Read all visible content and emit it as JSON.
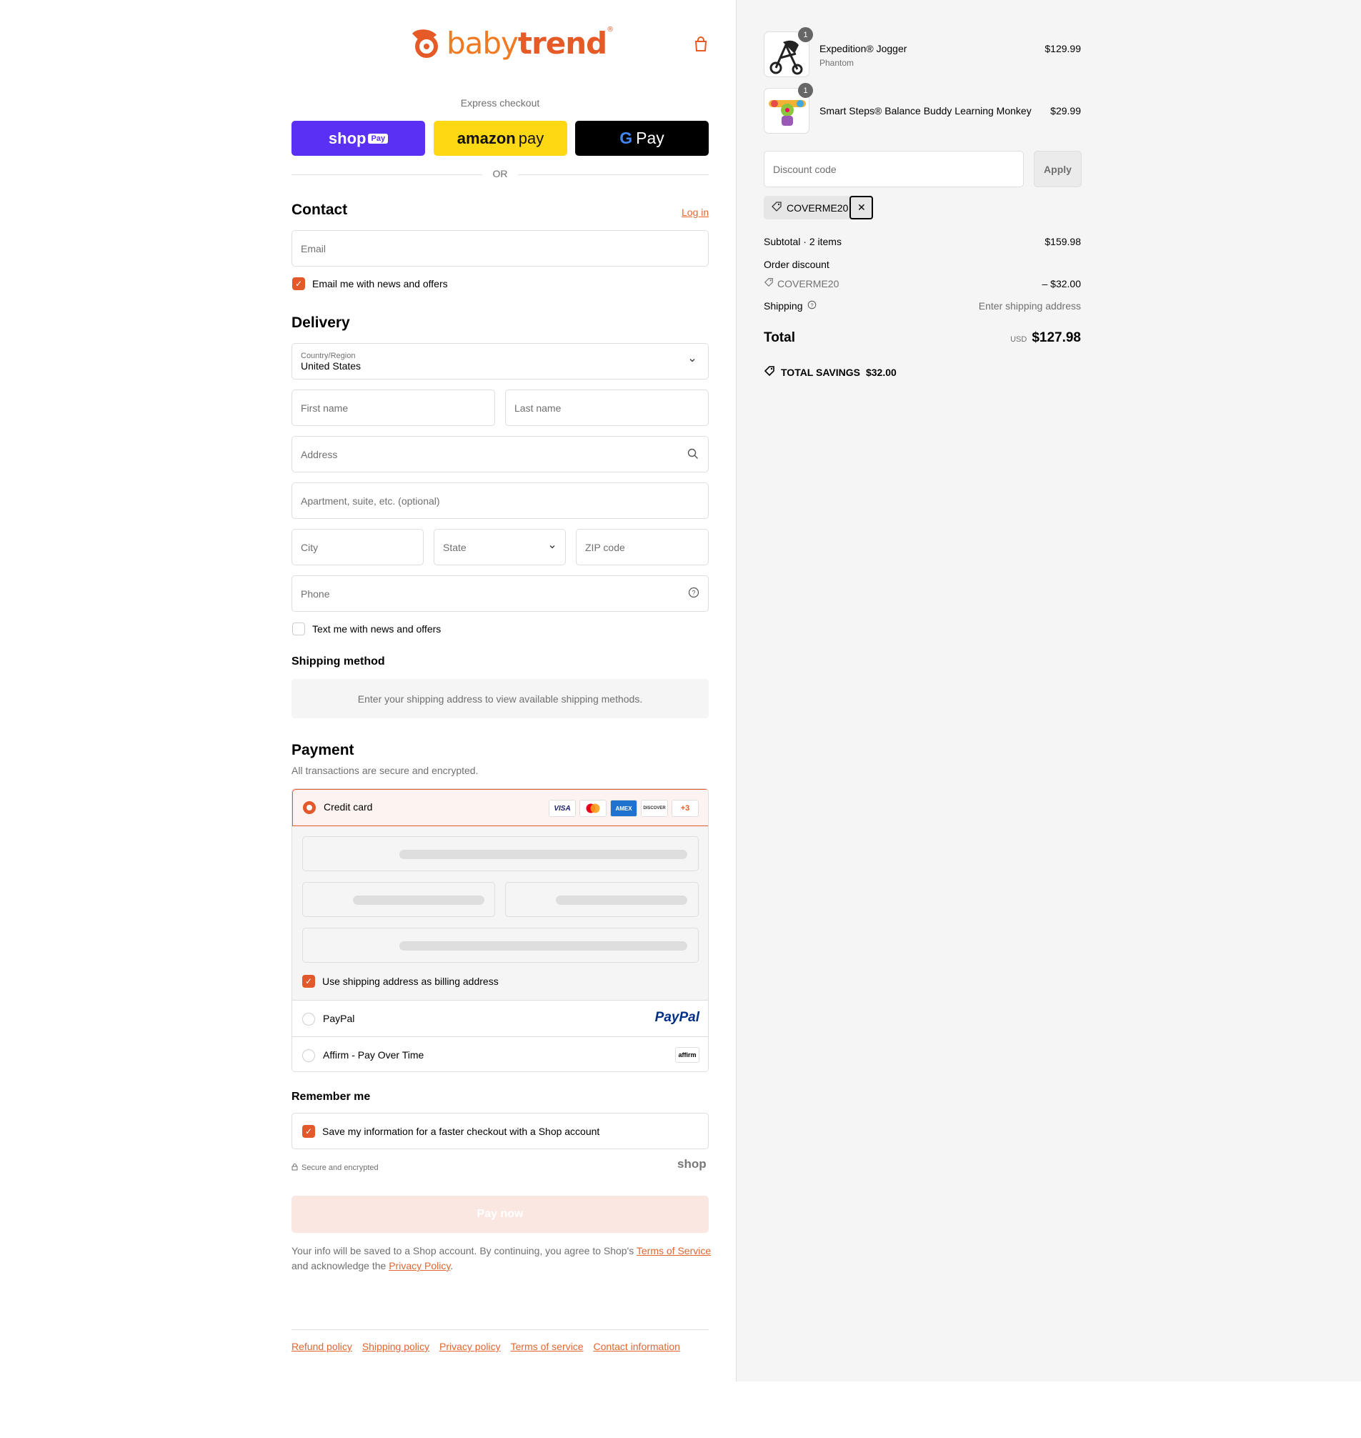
{
  "brand": {
    "name_part1": "baby",
    "name_part2": "trend",
    "reg": "®"
  },
  "express": {
    "label": "Express checkout",
    "shop_pay": "shop",
    "shop_pay_badge": "Pay",
    "amazon_pay_bold": "amazon",
    "amazon_pay_rest": "pay",
    "g_pay_g": "G",
    "g_pay_text": "Pay",
    "or": "OR"
  },
  "contact": {
    "title": "Contact",
    "login": "Log in",
    "email_placeholder": "Email",
    "newsletter_label": "Email me with news and offers"
  },
  "delivery": {
    "title": "Delivery",
    "country_label": "Country/Region",
    "country_value": "United States",
    "first_name": "First name",
    "last_name": "Last name",
    "address": "Address",
    "apartment": "Apartment, suite, etc. (optional)",
    "city": "City",
    "state": "State",
    "zip": "ZIP code",
    "phone": "Phone",
    "sms_label": "Text me with news and offers"
  },
  "shipping_method": {
    "title": "Shipping method",
    "info": "Enter your shipping address to view available shipping methods."
  },
  "payment": {
    "title": "Payment",
    "subtitle": "All transactions are secure and encrypted.",
    "credit_card": "Credit card",
    "cards": [
      "VISA",
      "MC",
      "AMEX",
      "DISCOVER",
      "+3"
    ],
    "billing_label": "Use shipping address as billing address",
    "paypal": "PayPal",
    "paypal_logo": "PayPal",
    "affirm": "Affirm - Pay Over Time",
    "affirm_logo": "affirm"
  },
  "remember": {
    "title": "Remember me",
    "save_label": "Save my information for a faster checkout with a Shop account",
    "secure": "Secure and encrypted",
    "shop_logo": "shop"
  },
  "pay_now": "Pay now",
  "terms": {
    "text1": "Your info will be saved to a Shop account. By continuing, you agree to Shop's ",
    "terms_link": "Terms of Service",
    "text2": "and acknowledge the ",
    "privacy_link": "Privacy Policy",
    "text3": "."
  },
  "footer": {
    "links": [
      "Refund policy",
      "Shipping policy",
      "Privacy policy",
      "Terms of service",
      "Contact information"
    ]
  },
  "cart": {
    "items": [
      {
        "name": "Expedition® Jogger",
        "variant": "Phantom",
        "price": "$129.99",
        "qty": "1"
      },
      {
        "name": "Smart Steps® Balance Buddy Learning Monkey",
        "variant": "",
        "price": "$29.99",
        "qty": "1"
      }
    ],
    "discount_placeholder": "Discount code",
    "apply": "Apply",
    "applied_code": "COVERME20",
    "subtotal_label": "Subtotal · 2 items",
    "subtotal_value": "$159.98",
    "order_discount_label": "Order discount",
    "discount_code": "COVERME20",
    "discount_value": "– $32.00",
    "shipping_label": "Shipping",
    "shipping_value": "Enter shipping address",
    "total_label": "Total",
    "currency": "USD",
    "total_value": "$127.98",
    "savings_label": "TOTAL SAVINGS",
    "savings_value": "$32.00"
  },
  "colors": {
    "accent": "#e25a2b",
    "shop_pay": "#5a31f4",
    "amazon": "#ffd814"
  }
}
